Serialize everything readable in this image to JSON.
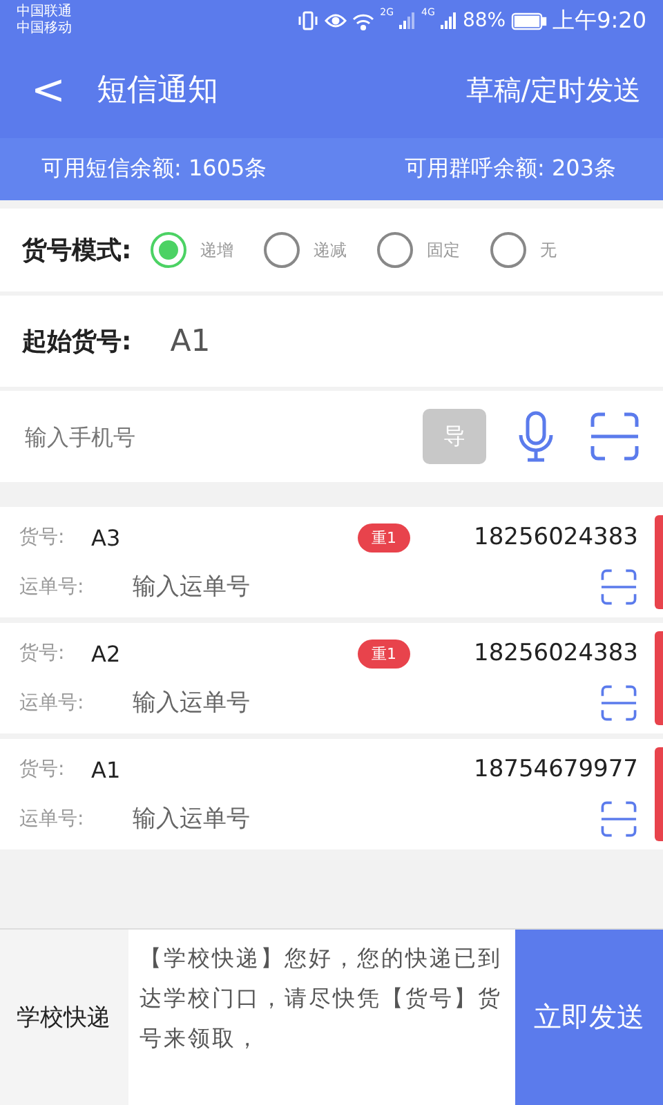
{
  "status_bar": {
    "carriers": [
      "中国联通",
      "中国移动"
    ],
    "network_1": "2G",
    "network_2": "4G",
    "battery": "88%",
    "time": "上午9:20"
  },
  "header": {
    "back": "<",
    "title": "短信通知",
    "action": "草稿/定时发送"
  },
  "quota": {
    "sms": "可用短信余额: 1605条",
    "call": "可用群呼余额: 203条"
  },
  "mode": {
    "label": "货号模式:",
    "options": [
      {
        "label": "递增",
        "selected": true
      },
      {
        "label": "递减",
        "selected": false
      },
      {
        "label": "固定",
        "selected": false
      },
      {
        "label": "无",
        "selected": false
      }
    ]
  },
  "start_number": {
    "label": "起始货号:",
    "value": "A1"
  },
  "phone_input": {
    "placeholder": "输入手机号",
    "import_button": "导"
  },
  "entries": [
    {
      "number_label": "货号:",
      "number": "A3",
      "badge": "重1",
      "phone": "18256024383",
      "waybill_label": "运单号:",
      "waybill_placeholder": "输入运单号"
    },
    {
      "number_label": "货号:",
      "number": "A2",
      "badge": "重1",
      "phone": "18256024383",
      "waybill_label": "运单号:",
      "waybill_placeholder": "输入运单号"
    },
    {
      "number_label": "货号:",
      "number": "A1",
      "phone": "18754679977",
      "waybill_label": "运单号:",
      "waybill_placeholder": "输入运单号"
    }
  ],
  "footer": {
    "template_name": "学校快递",
    "message": "【学校快递】您好，您的快递已到达学校门口，请尽快凭【货号】货号来领取，",
    "send_button": "立即发送"
  }
}
